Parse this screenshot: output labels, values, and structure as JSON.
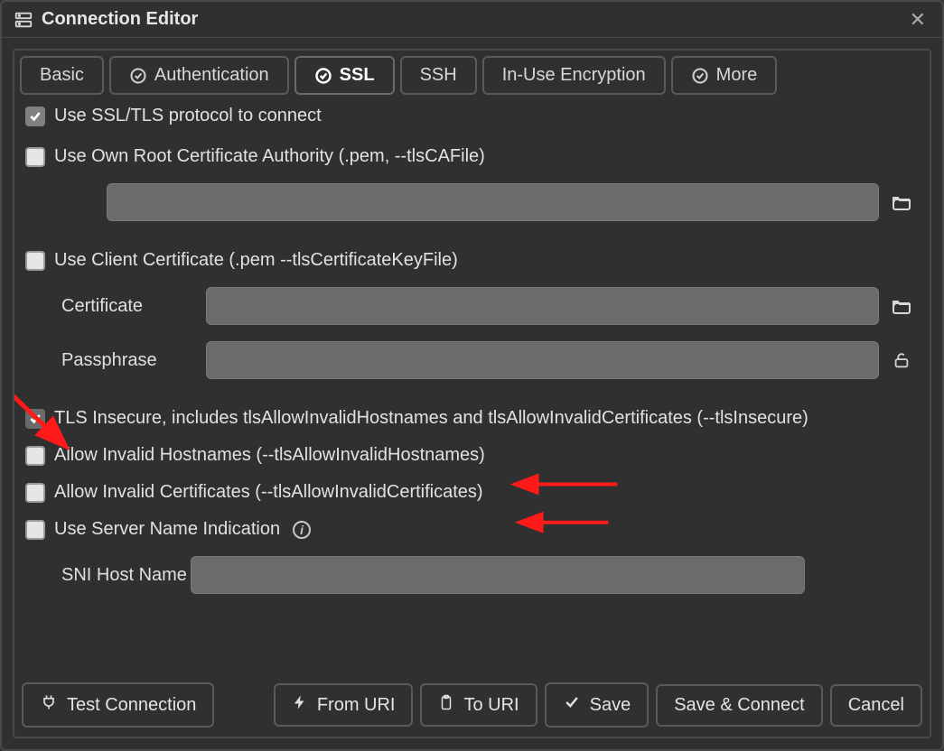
{
  "window": {
    "title": "Connection Editor"
  },
  "tabs": [
    {
      "label": "Basic",
      "icon": false,
      "active": false
    },
    {
      "label": "Authentication",
      "icon": true,
      "active": false
    },
    {
      "label": "SSL",
      "icon": true,
      "active": true
    },
    {
      "label": "SSH",
      "icon": false,
      "active": false
    },
    {
      "label": "In-Use Encryption",
      "icon": false,
      "active": false
    },
    {
      "label": "More",
      "icon": true,
      "active": false
    }
  ],
  "ssl_panel": {
    "use_ssl": {
      "label": "Use SSL/TLS protocol to connect",
      "checked": true
    },
    "own_root_ca": {
      "label": "Use Own Root Certificate Authority (.pem, --tlsCAFile)",
      "checked": false,
      "path": ""
    },
    "client_cert": {
      "label": "Use Client Certificate (.pem --tlsCertificateKeyFile)",
      "checked": false,
      "certificate_label": "Certificate",
      "certificate_path": "",
      "passphrase_label": "Passphrase",
      "passphrase_value": ""
    },
    "tls_insecure": {
      "label": "TLS Insecure, includes tlsAllowInvalidHostnames and tlsAllowInvalidCertificates (--tlsInsecure)",
      "checked": true
    },
    "allow_invalid_hostnames": {
      "label": "Allow Invalid Hostnames (--tlsAllowInvalidHostnames)",
      "checked": false
    },
    "allow_invalid_certs": {
      "label": "Allow Invalid Certificates (--tlsAllowInvalidCertificates)",
      "checked": false
    },
    "use_sni": {
      "label": "Use Server Name Indication",
      "checked": false,
      "host_label": "SNI Host Name",
      "host_value": ""
    }
  },
  "footer": {
    "test": "Test Connection",
    "fromuri": "From URI",
    "touri": "To URI",
    "save": "Save",
    "connect": "Save & Connect",
    "cancel": "Cancel"
  },
  "icons": {
    "server": "server-icon",
    "close": "close-icon",
    "check": "check-icon",
    "folder": "folder-open-icon",
    "lock": "lock-icon",
    "plug": "plug-icon",
    "bolt": "bolt-icon",
    "clipboard": "clipboard-icon"
  }
}
